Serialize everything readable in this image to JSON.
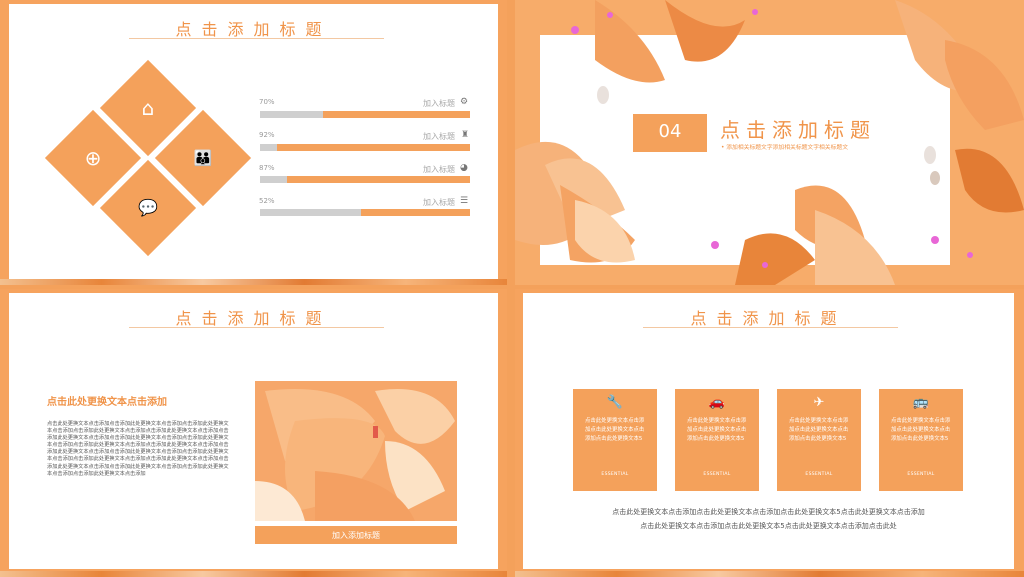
{
  "colors": {
    "accent": "#f4a15b",
    "title": "#f0944a",
    "track": "#cfcfcf"
  },
  "slide1": {
    "title": "点击添加标题",
    "hex_icons": [
      "home-icon",
      "plus-circle-icon",
      "people-icon",
      "chat-bubble-icon"
    ],
    "progress": [
      {
        "percent_label": "70%",
        "value": 0.7,
        "label": "加入标题",
        "icon": "gear-icon"
      },
      {
        "percent_label": "92%",
        "value": 0.92,
        "label": "加入标题",
        "icon": "shield-icon"
      },
      {
        "percent_label": "87%",
        "value": 0.87,
        "label": "加入标题",
        "icon": "pie-icon"
      },
      {
        "percent_label": "52%",
        "value": 0.52,
        "label": "加入标题",
        "icon": "list-icon"
      }
    ]
  },
  "slide2": {
    "number": "04",
    "title": "点击添加标题",
    "subtitle": "• 添加相关标题文字添加相关标题文字相关标题文"
  },
  "slide3": {
    "title": "点击添加标题",
    "heading": "点击此处更换文本点击添加",
    "body": "点击此处更换文本点击添加点击添加此处更换文本点击添加点击添加此处更换文本点击添加点击添加此处更换文本点击添加点击添加此处更换文本点击添加点击添加此处更换文本点击添加点击添加此处更换文本点击添加点击添加此处更换文本点击添加点击添加此处更换文本点击添加点击添加此处更换文本点击添加点击添加此处更换文本点击添加点击添加此处更换文本点击添加点击添加此处更换文本点击添加点击添加此处更换文本点击添加点击添加此处更换文本点击添加点击添加此处更换文本点击添加点击添加此处更换文本点击添加点击添加此处更换文本点击添加点击添加此处更换文本点击添加",
    "image_caption": "加入添加标题"
  },
  "slide4": {
    "title": "点击添加标题",
    "cards": [
      {
        "icon": "wrench-icon",
        "glyph": "🔧",
        "text": "点击此处更换文本点击添加点击此处更换文本点击添加点击此处更换文本5",
        "tag": "ESSENTIAL"
      },
      {
        "icon": "car-icon",
        "glyph": "🚗",
        "text": "点击此处更换文本点击添加点击此处更换文本点击添加点击此处更换文本5",
        "tag": "ESSENTIAL"
      },
      {
        "icon": "airplane-icon",
        "glyph": "✈",
        "text": "点击此处更换文本点击添加点击此处更换文本点击添加点击此处更换文本5",
        "tag": "ESSENTIAL"
      },
      {
        "icon": "bus-icon",
        "glyph": "🚌",
        "text": "点击此处更换文本点击添加点击此处更换文本点击添加点击此处更换文本5",
        "tag": "ESSENTIAL"
      }
    ],
    "footer_line1": "点击此处更换文本点击添加点击此处更换文本点击添加点击此处更换文本5点击此处更换文本点击添加",
    "footer_line2": "点击此处更换文本点击添加点击此处更换文本5点击此处更换文本点击添加点击此处"
  }
}
